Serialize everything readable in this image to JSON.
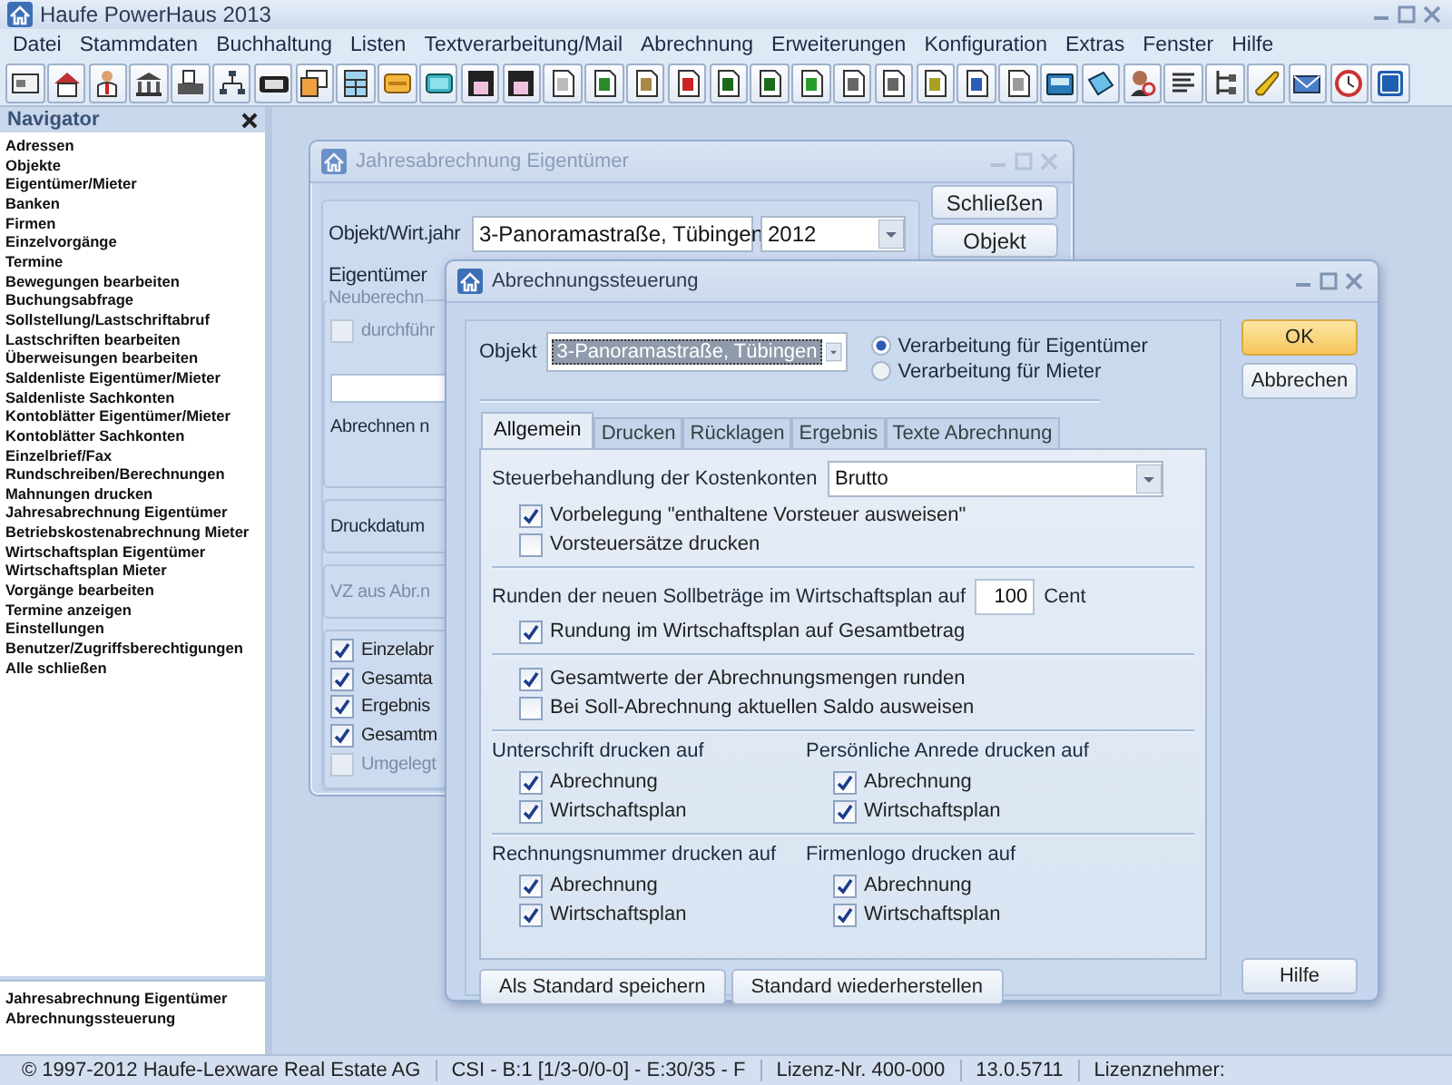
{
  "window": {
    "title": "Haufe PowerHaus 2013"
  },
  "menu": [
    "Datei",
    "Stammdaten",
    "Buchhaltung",
    "Listen",
    "Textverarbeitung/Mail",
    "Abrechnung",
    "Erweiterungen",
    "Konfiguration",
    "Extras",
    "Fenster",
    "Hilfe"
  ],
  "navigator": {
    "title": "Navigator",
    "items": [
      "Adressen",
      "Objekte",
      "Eigentümer/Mieter",
      "Banken",
      "Firmen",
      "Einzelvorgänge",
      "Termine",
      "Bewegungen bearbeiten",
      "Buchungsabfrage",
      "Sollstellung/Lastschriftabruf",
      "Lastschriften bearbeiten",
      "Überweisungen bearbeiten",
      "Saldenliste Eigentümer/Mieter",
      "Saldenliste Sachkonten",
      "Kontoblätter Eigentümer/Mieter",
      "Kontoblätter Sachkonten",
      "Einzelbrief/Fax",
      "Rundschreiben/Berechnungen",
      "Mahnungen drucken",
      "Jahresabrechnung Eigentümer",
      "Betriebskostenabrechnung Mieter",
      "Wirtschaftsplan Eigentümer",
      "Wirtschaftsplan Mieter",
      "Vorgänge bearbeiten",
      "Termine anzeigen",
      "Einstellungen",
      "Benutzer/Zugriffsberechtigungen",
      "Alle schließen"
    ]
  },
  "open_windows": [
    "Jahresabrechnung Eigentümer",
    "Abrechnungssteuerung"
  ],
  "background_dialog": {
    "title": "Jahresabrechnung Eigentümer",
    "object_label": "Objekt/Wirt.jahr",
    "object_value": "3-Panoramastraße, Tübingen",
    "year_value": "2012",
    "owner_label": "Eigentümer",
    "buttons": [
      "Schließen",
      "Objekt"
    ],
    "recalc_title": "Neuberechn",
    "recalc_checkbox": {
      "label": "durchführ",
      "checked": false,
      "disabled": true
    },
    "bill_label": "Abrechnen n",
    "print_date_label": "Druckdatum",
    "prepayment_label": "VZ aus Abr.n",
    "options": [
      {
        "label": "Einzelabr",
        "checked": true,
        "disabled": false
      },
      {
        "label": "Gesamta",
        "checked": true,
        "disabled": false
      },
      {
        "label": "Ergebnis",
        "checked": true,
        "disabled": false
      },
      {
        "label": "Gesamtm",
        "checked": true,
        "disabled": false
      },
      {
        "label": "Umgelegt",
        "checked": false,
        "disabled": true
      }
    ]
  },
  "dialog": {
    "title": "Abrechnungssteuerung",
    "object_label": "Objekt",
    "object_value": "3-Panoramastraße, Tübingen",
    "modes": [
      {
        "label": "Verarbeitung für Eigentümer",
        "selected": true
      },
      {
        "label": "Verarbeitung für Mieter",
        "selected": false
      }
    ],
    "tabs": [
      {
        "label": "Allgemein",
        "selected": true
      },
      {
        "label": "Drucken",
        "selected": false
      },
      {
        "label": "Rücklagen",
        "selected": false
      },
      {
        "label": "Ergebnis",
        "selected": false
      },
      {
        "label": "Texte Abrechnung",
        "selected": false
      }
    ],
    "tax": {
      "label": "Steuerbehandlung der Kostenkonten",
      "value": "Brutto",
      "options": [
        {
          "label": "Vorbelegung \"enthaltene Vorsteuer ausweisen\"",
          "checked": true
        },
        {
          "label": "Vorsteuersätze drucken",
          "checked": false
        }
      ]
    },
    "rounding": {
      "label": "Runden der neuen Sollbeträge im Wirtschaftsplan auf",
      "value": "100",
      "unit": "Cent",
      "options": [
        {
          "label": "Rundung im Wirtschaftsplan auf Gesamtbetrag",
          "checked": true
        }
      ]
    },
    "totals": [
      {
        "label": "Gesamtwerte der Abrechnungsmengen runden",
        "checked": true
      },
      {
        "label": "Bei Soll-Abrechnung aktuellen Saldo ausweisen",
        "checked": false
      }
    ],
    "print_groups": [
      [
        {
          "title": "Unterschrift drucken auf",
          "options": [
            {
              "label": "Abrechnung",
              "checked": true
            },
            {
              "label": "Wirtschaftsplan",
              "checked": true
            }
          ]
        },
        {
          "title": "Persönliche Anrede drucken auf",
          "options": [
            {
              "label": "Abrechnung",
              "checked": true
            },
            {
              "label": "Wirtschaftsplan",
              "checked": true
            }
          ]
        }
      ],
      [
        {
          "title": "Rechnungsnummer drucken auf",
          "options": [
            {
              "label": "Abrechnung",
              "checked": true
            },
            {
              "label": "Wirtschaftsplan",
              "checked": true
            }
          ]
        },
        {
          "title": "Firmenlogo drucken auf",
          "options": [
            {
              "label": "Abrechnung",
              "checked": true
            },
            {
              "label": "Wirtschaftsplan",
              "checked": true
            }
          ]
        }
      ]
    ],
    "bottom_buttons": [
      "Als Standard speichern",
      "Standard wiederherstellen"
    ],
    "side_buttons": [
      {
        "label": "OK",
        "kind": "default"
      },
      {
        "label": "Abbrechen",
        "kind": "normal"
      },
      {
        "label": "Hilfe",
        "kind": "normal"
      }
    ]
  },
  "status_bar": [
    "© 1997-2012 Haufe-Lexware Real Estate AG",
    "CSI - B:1 [1/3-0/0-0] - E:30/35 - F",
    "Lizenz-Nr. 400-000",
    "13.0.5711",
    "Lizenznehmer:"
  ]
}
